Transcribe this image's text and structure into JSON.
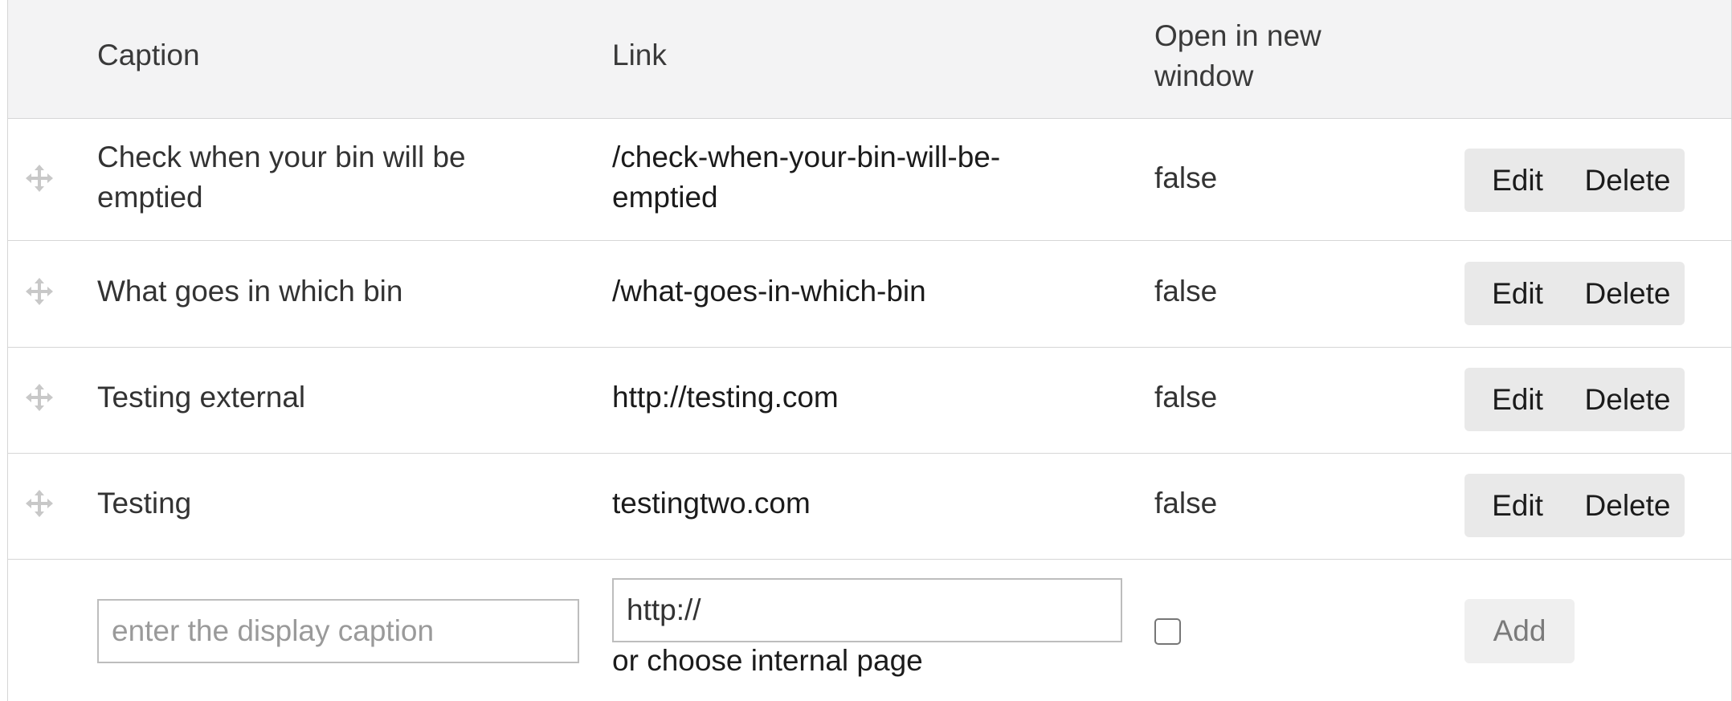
{
  "headers": {
    "caption": "Caption",
    "link": "Link",
    "open_line1": "Open in new",
    "open_line2": "window"
  },
  "rows": [
    {
      "caption_line1": "Check when your bin will be",
      "caption_line2": "emptied",
      "link_line1": "/check-when-your-bin-will-be-",
      "link_line2": "emptied",
      "open": "false",
      "edit": "Edit",
      "delete": "Delete"
    },
    {
      "caption": "What goes in which bin",
      "link": "/what-goes-in-which-bin",
      "open": "false",
      "edit": "Edit",
      "delete": "Delete"
    },
    {
      "caption": "Testing external",
      "link": "http://testing.com",
      "open": "false",
      "edit": "Edit",
      "delete": "Delete"
    },
    {
      "caption": "Testing",
      "link": "testingtwo.com",
      "open": "false",
      "edit": "Edit",
      "delete": "Delete"
    }
  ],
  "new_entry": {
    "caption_placeholder": "enter the display caption",
    "link_value": "http://",
    "or_text": "or",
    "choose_internal": "choose internal page",
    "add_label": "Add",
    "open_checked": false
  },
  "icons": {
    "drag": "move-icon"
  },
  "colors": {
    "header_bg": "#f3f3f4",
    "button_bg": "#e9e9e9",
    "border": "#d6d6d6"
  }
}
